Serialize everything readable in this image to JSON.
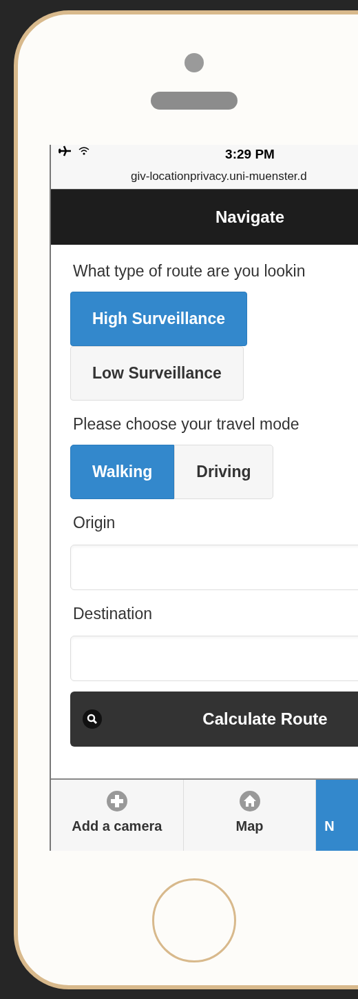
{
  "status_bar": {
    "time": "3:29 PM",
    "url": "giv-locationprivacy.uni-muenster.d"
  },
  "header": {
    "title": "Navigate"
  },
  "route_question": "What type of route are you lookin",
  "route_options": [
    {
      "label": "High Surveillance",
      "selected": true
    },
    {
      "label": "Low Surveillance",
      "selected": false
    }
  ],
  "travel_prompt": "Please choose your travel mode",
  "travel_modes": [
    {
      "label": "Walking",
      "selected": true
    },
    {
      "label": "Driving",
      "selected": false
    }
  ],
  "fields": [
    {
      "label": "Origin"
    },
    {
      "label": "Destination"
    }
  ],
  "calculate_button": {
    "label": "Calculate Route"
  },
  "tab_bar": [
    {
      "label": "Add a camera",
      "kind": "plus",
      "selected": false
    },
    {
      "label": "Map",
      "kind": "home",
      "selected": false
    },
    {
      "label": "N",
      "kind": "none",
      "selected": true
    }
  ]
}
